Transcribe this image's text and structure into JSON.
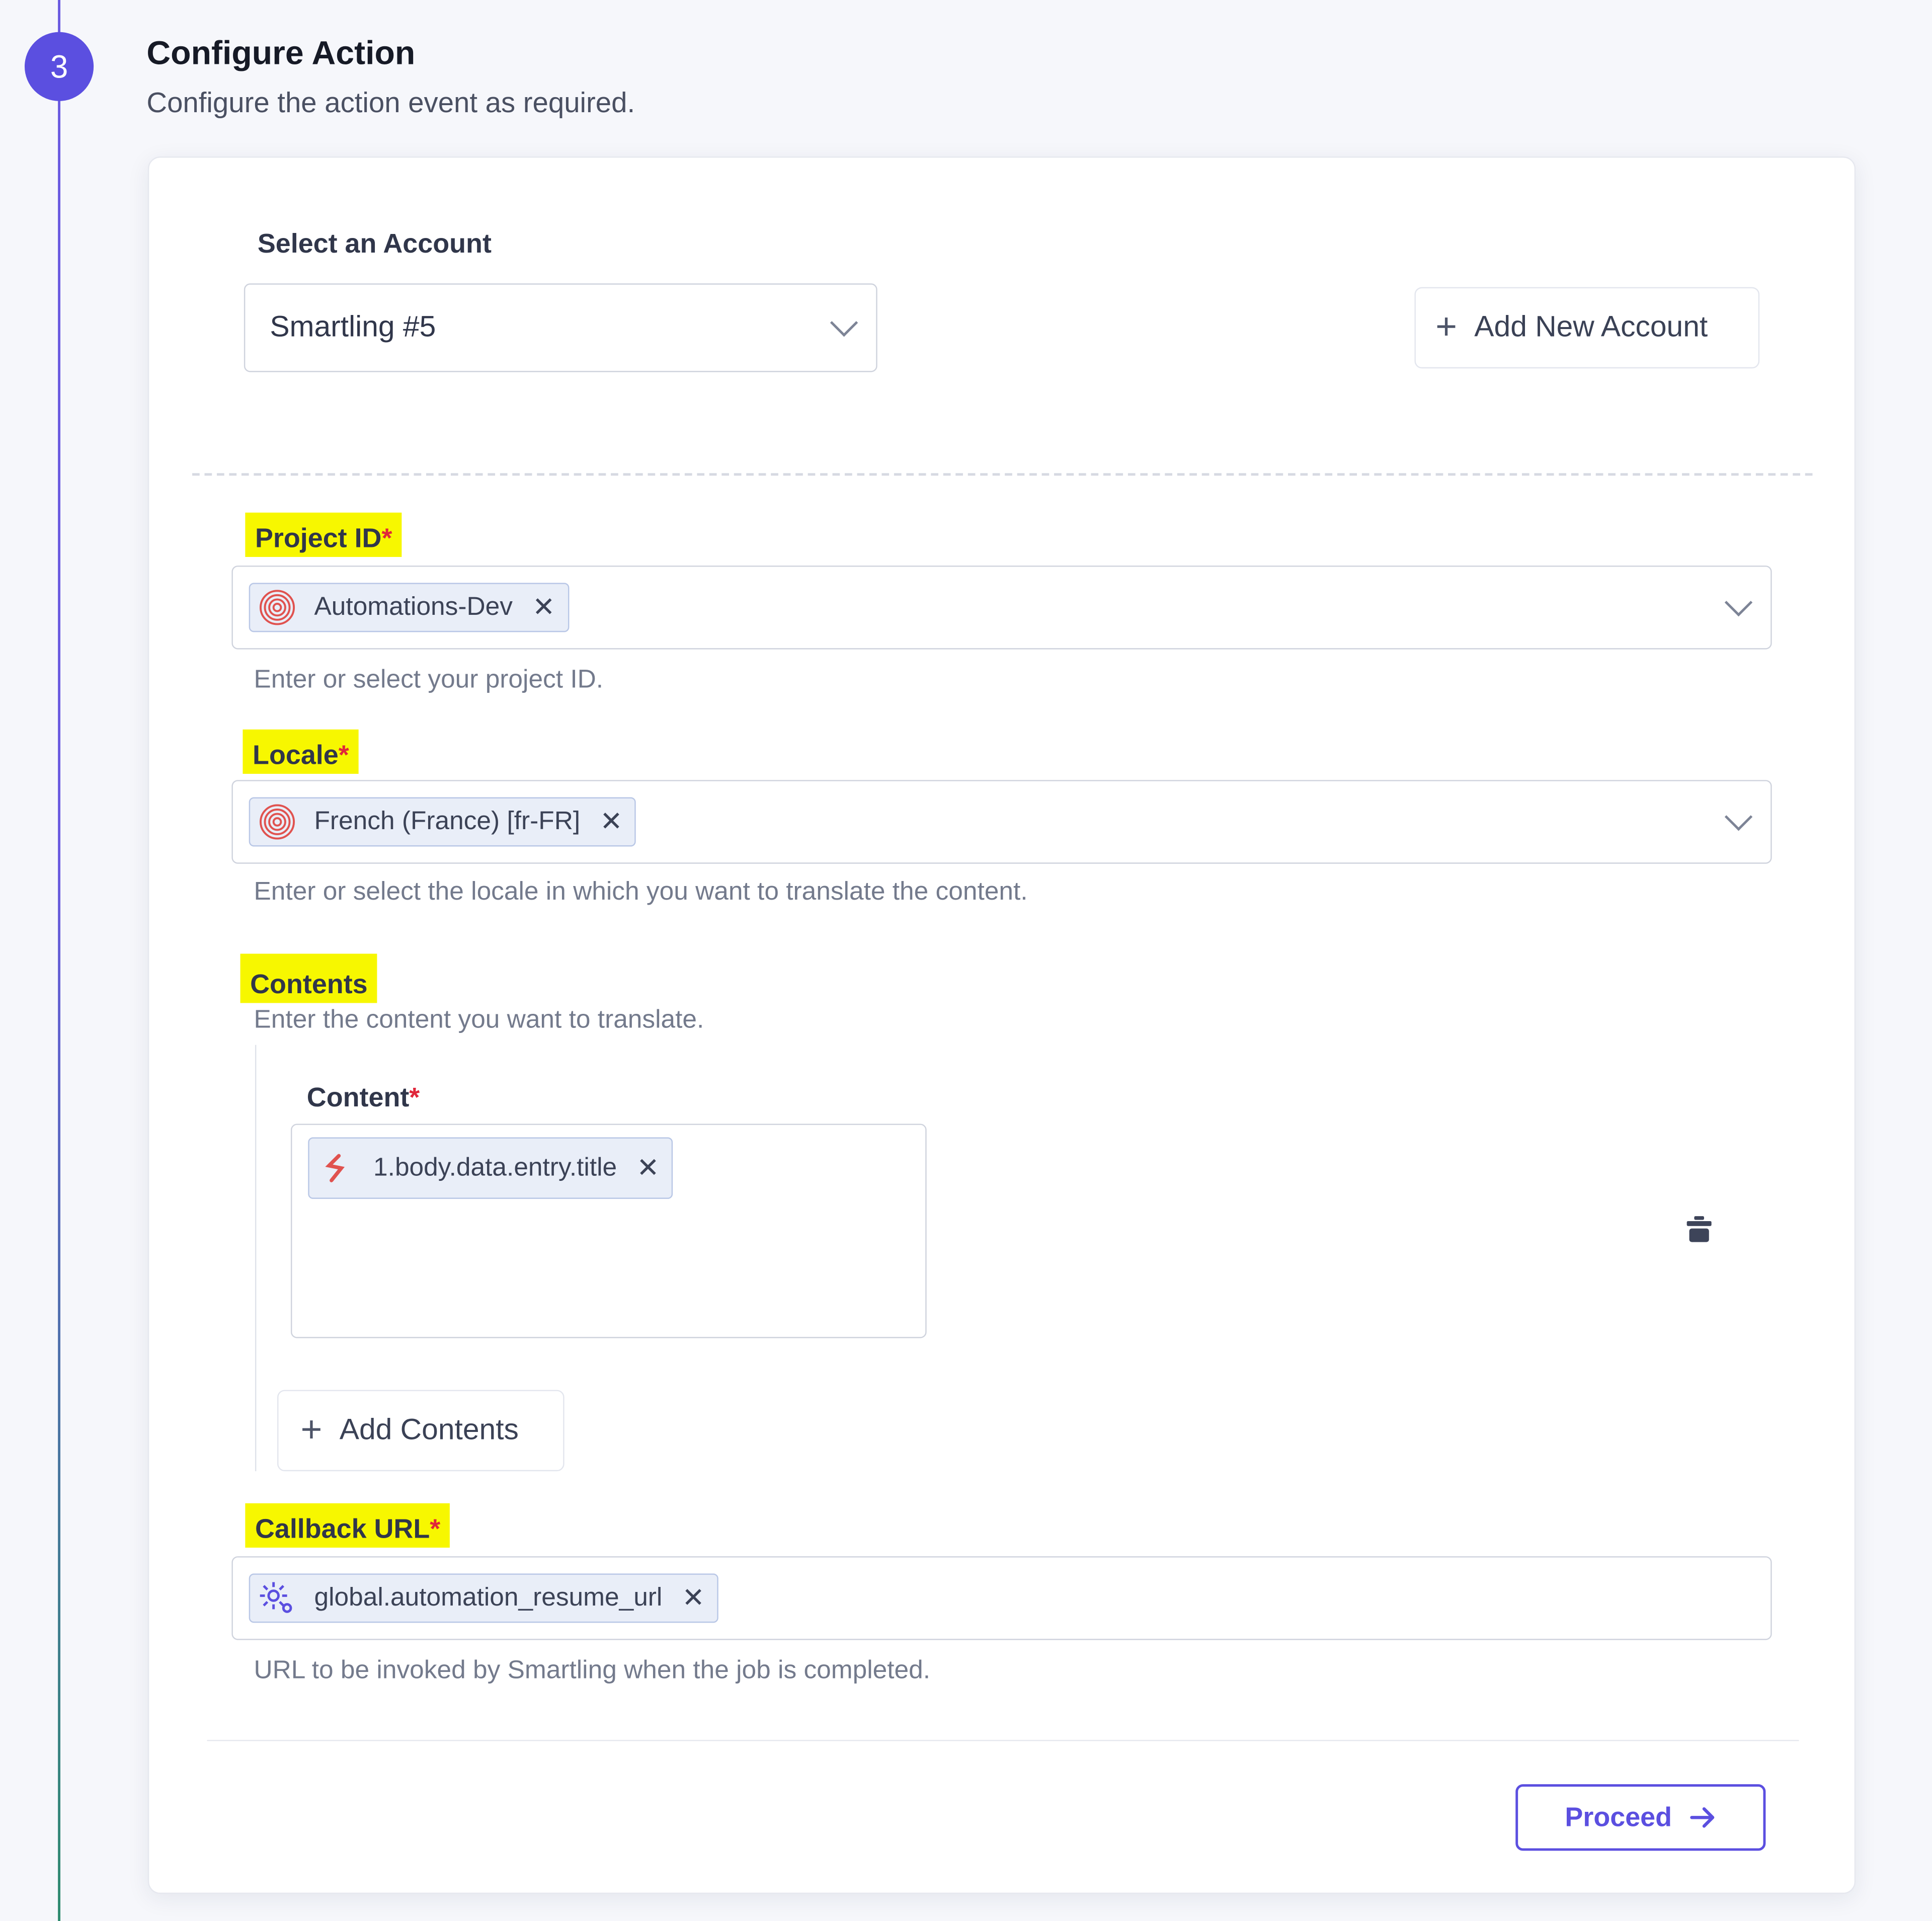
{
  "step": {
    "number": "3",
    "title": "Configure Action",
    "subtitle": "Configure the action event as required."
  },
  "account": {
    "label": "Select an Account",
    "selected": "Smartling #5",
    "add_button": "Add New Account"
  },
  "fields": {
    "project_id": {
      "label": "Project ID",
      "required_mark": "*",
      "chip": "Automations-Dev",
      "chip_icon": "fingerprint-icon",
      "help": "Enter or select your project ID."
    },
    "locale": {
      "label": "Locale",
      "required_mark": "*",
      "chip": "French (France) [fr-FR]",
      "chip_icon": "fingerprint-icon",
      "help": "Enter or select the locale in which you want to translate the content."
    },
    "contents": {
      "label": "Contents",
      "help": "Enter the content you want to translate.",
      "content_label": "Content",
      "required_mark": "*",
      "chip": "1.body.data.entry.title",
      "chip_icon": "webhook-icon",
      "add_button": "Add Contents"
    },
    "callback_url": {
      "label": "Callback URL",
      "required_mark": "*",
      "chip": "global.automation_resume_url",
      "chip_icon": "gear-icon",
      "help": "URL to be invoked by Smartling when the job is completed."
    }
  },
  "footer": {
    "proceed_button": "Proceed"
  },
  "colors": {
    "accent": "#5b4fe0",
    "highlight": "#f7f700",
    "required": "#e0263a",
    "chip_bg": "#e9eef8"
  }
}
